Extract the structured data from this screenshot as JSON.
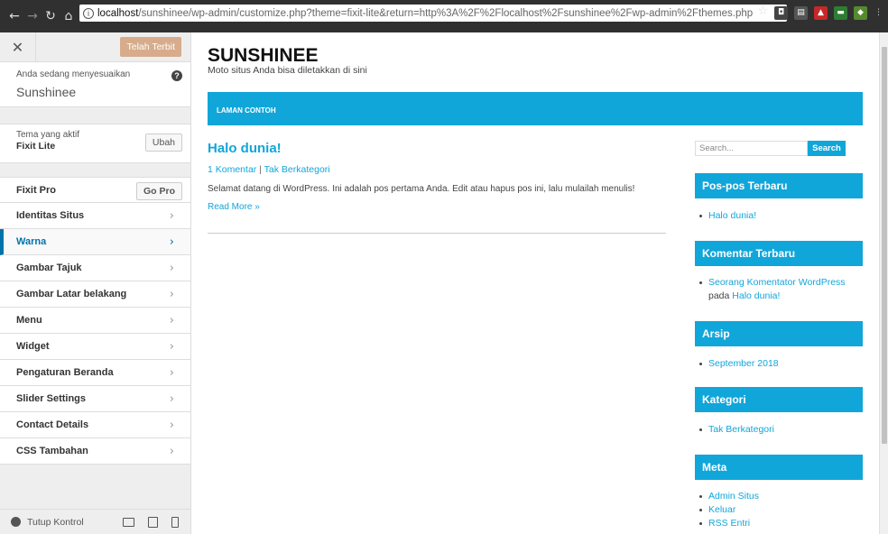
{
  "browser": {
    "url_host": "localhost",
    "url_rest": "/sunshinee/wp-admin/customize.php?theme=fixit-lite&return=http%3A%2F%2Flocalhost%2Fsunshinee%2Fwp-admin%2Fthemes.php"
  },
  "customizer": {
    "published_label": "Telah Terbit",
    "customizing_label": "Anda sedang menyesuaikan",
    "site_name": "Sunshinee",
    "active_theme_label": "Tema yang aktif",
    "active_theme_name": "Fixit Lite",
    "change_label": "Ubah",
    "fixit_pro_label": "Fixit Pro",
    "go_pro_label": "Go Pro",
    "sections": [
      "Identitas Situs",
      "Warna",
      "Gambar Tajuk",
      "Gambar Latar belakang",
      "Menu",
      "Widget",
      "Pengaturan Beranda",
      "Slider Settings",
      "Contact Details",
      "CSS Tambahan"
    ],
    "active_section": "Warna",
    "collapse_label": "Tutup Kontrol"
  },
  "site": {
    "title": "SUNSHINEE",
    "tagline": "Moto situs Anda bisa diletakkan di sini",
    "nav_link": "LAMAN CONTOH",
    "post": {
      "title": "Halo dunia!",
      "comments": "1 Komentar",
      "separator": "|",
      "category": "Tak Berkategori",
      "excerpt": "Selamat datang di WordPress. Ini adalah pos pertama Anda. Edit atau hapus pos ini, lalu mulailah menulis!",
      "read_more": "Read More »"
    },
    "sidebar": {
      "search_placeholder": "Search...",
      "search_button": "Search",
      "recent_posts_title": "Pos-pos Terbaru",
      "recent_posts": [
        "Halo dunia!"
      ],
      "recent_comments_title": "Komentar Terbaru",
      "comment_author": "Seorang Komentator WordPress",
      "comment_on": "pada",
      "comment_post": "Halo dunia!",
      "archives_title": "Arsip",
      "archives": [
        "September 2018"
      ],
      "categories_title": "Kategori",
      "categories": [
        "Tak Berkategori"
      ],
      "meta_title": "Meta",
      "meta": [
        "Admin Situs",
        "Keluar",
        "RSS Entri"
      ]
    }
  },
  "colors": {
    "accent": "#11a6d9",
    "wp_blue": "#0073aa",
    "published": "#d7ac8c"
  }
}
